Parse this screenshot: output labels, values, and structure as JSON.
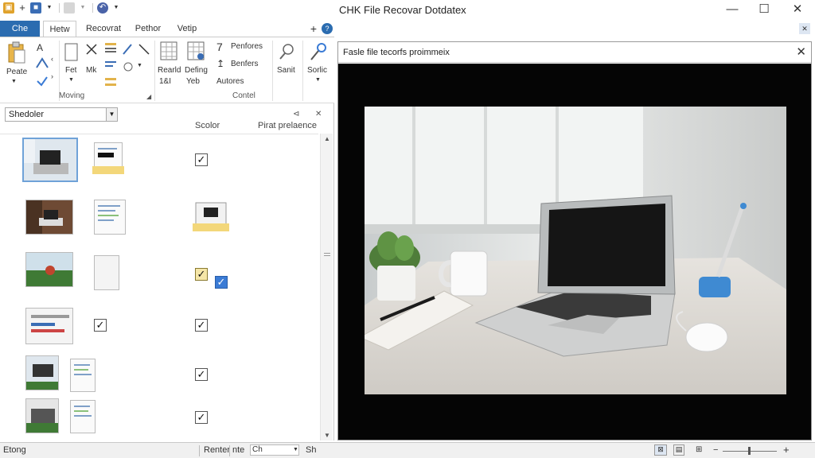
{
  "window": {
    "title": "CHK File Recovar Dotdatex",
    "minimize": "—",
    "maximize": "☐",
    "close": "✕"
  },
  "ribbon": {
    "tabs": [
      "Che",
      "Hetw",
      "Recovrat",
      "Pethor",
      "Vetip"
    ],
    "groups": {
      "clipboard": {
        "paste": "Peate",
        "label1": "A"
      },
      "moving": {
        "label": "Moving",
        "fet": "Fet",
        "mk": "Mk"
      },
      "control": {
        "label": "Contel",
        "rearld": "Rearld",
        "rearld2": "1&I",
        "defing": "Defing",
        "defing2": "Yeb",
        "penfores": "Penfores",
        "benfers": "Benfers",
        "autores": "Autores",
        "sanit": "Sanit",
        "sorlic": "Sorlic"
      }
    }
  },
  "left_pane": {
    "filter_value": "Shedoler",
    "column_headers": {
      "scolor": "Scolor",
      "pirat": "Pirat prelaence"
    },
    "rows": [
      {
        "c1": false,
        "c2": true
      },
      {
        "c1": false,
        "c2": false
      },
      {
        "c1": false,
        "c2": true
      },
      {
        "c1": true,
        "c2": true
      },
      {
        "c1": false,
        "c2": true
      },
      {
        "c1": false,
        "c2": true
      }
    ]
  },
  "preview": {
    "title": "Fasle file tecorfs proimmeix",
    "close": "✕"
  },
  "statusbar": {
    "left": "Etong",
    "item1": "Renter",
    "item2": "nte",
    "item3": "Ch",
    "item4": "Sh"
  },
  "colors": {
    "file_tab": "#2b6cb0",
    "check_blue": "#3a7bd5",
    "preview_bg": "#050505"
  }
}
